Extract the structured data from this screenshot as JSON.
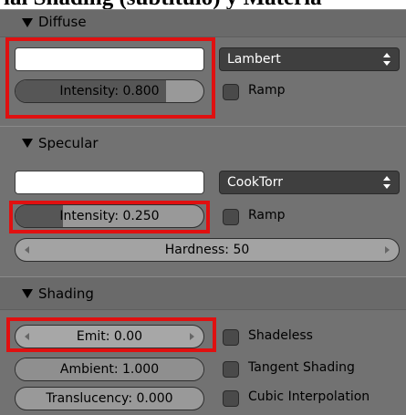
{
  "page": {
    "top_caption": "ial Shading (subtitulo) y Materia"
  },
  "diffuse": {
    "title": "Diffuse",
    "shader": "Lambert",
    "intensity_label": "Intensity: 0.800",
    "intensity_value": 0.8,
    "ramp_label": "Ramp"
  },
  "specular": {
    "title": "Specular",
    "shader": "CookTorr",
    "intensity_label": "Intensity: 0.250",
    "intensity_value": 0.25,
    "ramp_label": "Ramp",
    "hardness_label": "Hardness: 50"
  },
  "shading": {
    "title": "Shading",
    "emit_label": "Emit: 0.00",
    "ambient_label": "Ambient: 1.000",
    "translucency_label": "Translucency: 0.000",
    "shadeless_label": "Shadeless",
    "tangent_label": "Tangent Shading",
    "cubic_label": "Cubic Interpolation"
  },
  "colors": {
    "panel_bg": "#727272",
    "highlight": "#e01010",
    "swatch": "#ffffff"
  }
}
